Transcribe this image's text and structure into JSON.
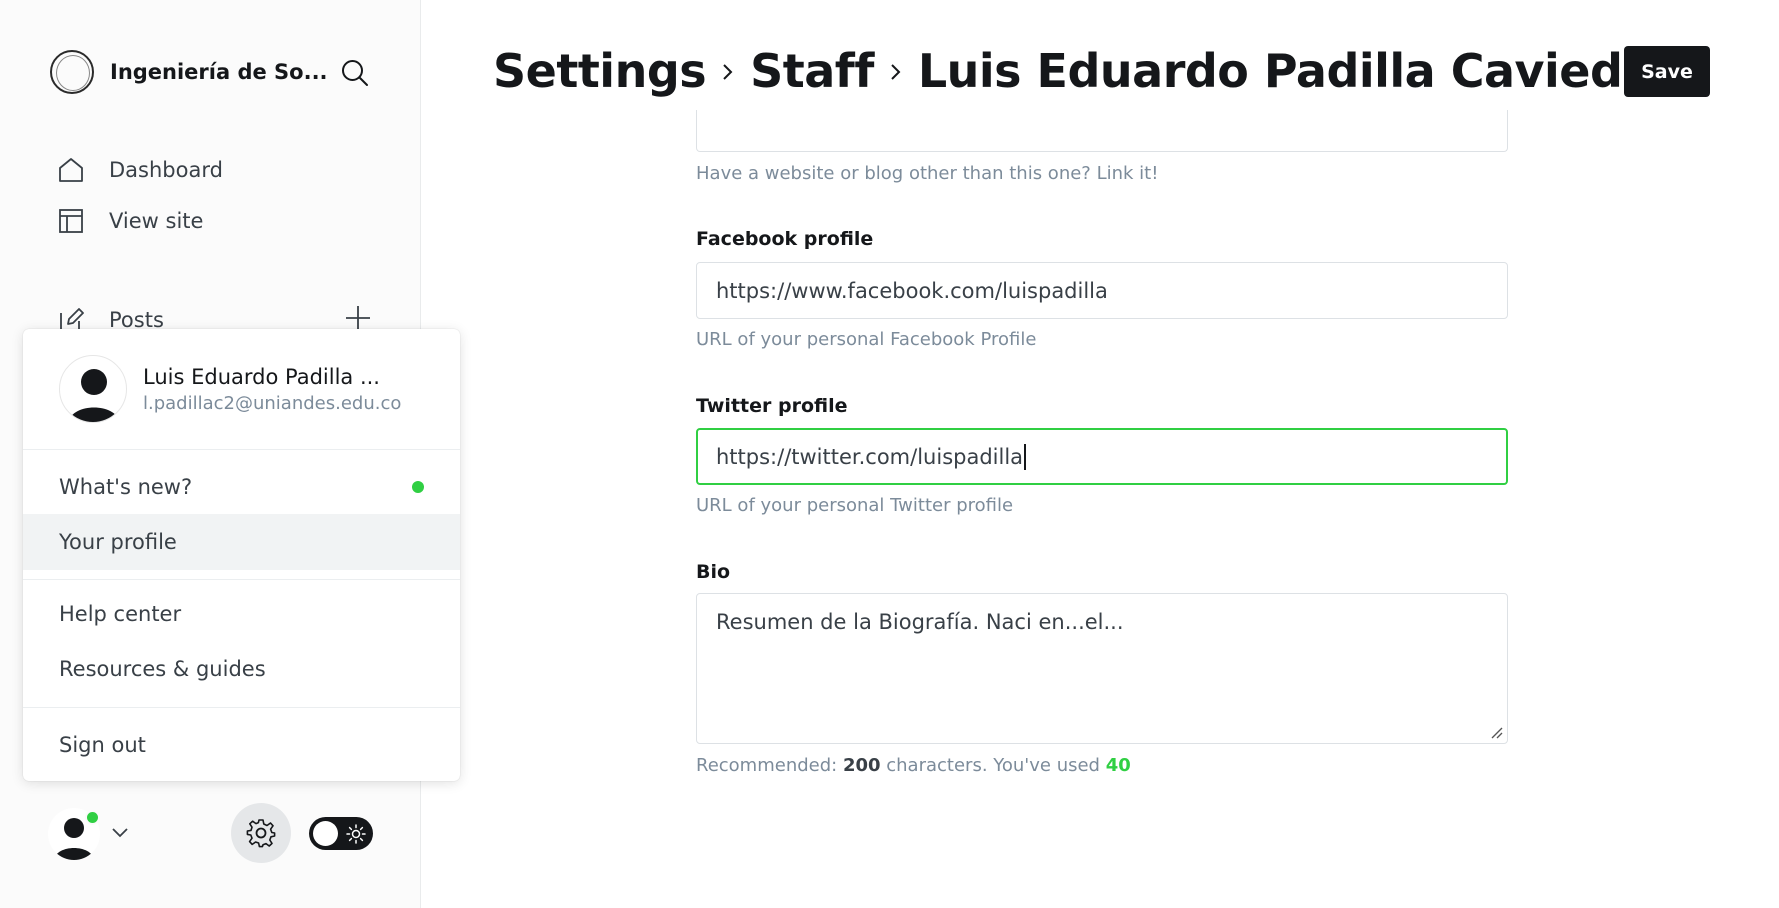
{
  "sidebar": {
    "site_name": "Ingeniería de So...",
    "nav": {
      "dashboard": "Dashboard",
      "view_site": "View site",
      "posts": "Posts"
    }
  },
  "user_menu": {
    "name": "Luis Eduardo Padilla ...",
    "email": "l.padillac2@uniandes.edu.co",
    "items": {
      "whats_new": "What's new?",
      "your_profile": "Your profile",
      "help_center": "Help center",
      "resources": "Resources & guides",
      "sign_out": "Sign out"
    }
  },
  "header": {
    "crumb1": "Settings",
    "crumb2": "Staff",
    "crumb3": "Luis Eduardo Padilla Caviedes",
    "save_label": "Save"
  },
  "form": {
    "website_hint": "Have a website or blog other than this one? Link it!",
    "facebook": {
      "label": "Facebook profile",
      "value": "https://www.facebook.com/luispadilla",
      "hint": "URL of your personal Facebook Profile"
    },
    "twitter": {
      "label": "Twitter profile",
      "value": "https://twitter.com/luispadilla",
      "hint": "URL of your personal Twitter profile"
    },
    "bio": {
      "label": "Bio",
      "value": "Resumen de la Biografía. Naci en...el...",
      "hint_prefix": "Recommended: ",
      "recommended": "200",
      "hint_middle": " characters. You've used ",
      "used": "40"
    }
  },
  "colors": {
    "accent_green": "#30cf43",
    "dark": "#15171a"
  }
}
